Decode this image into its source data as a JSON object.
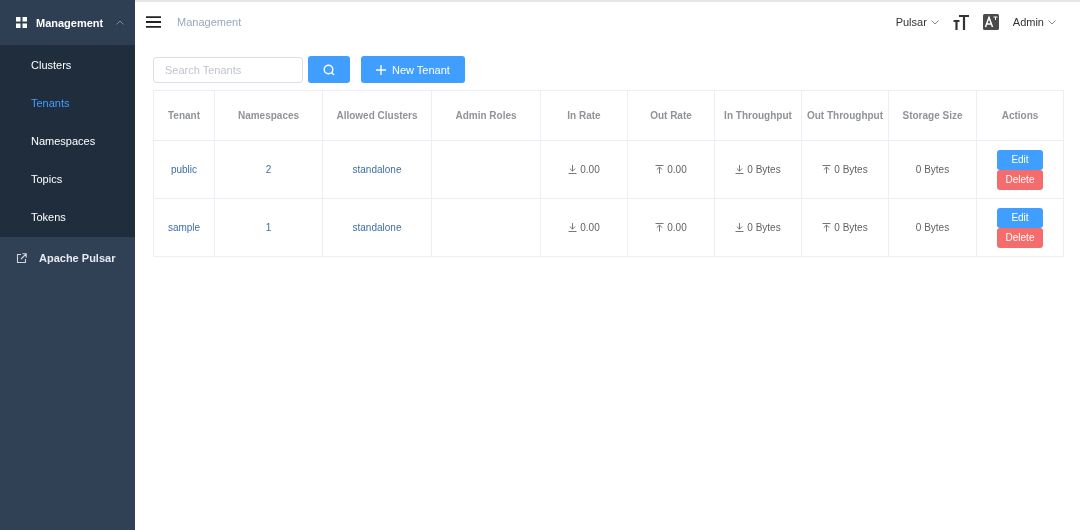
{
  "sidebar": {
    "group": {
      "label": "Management",
      "expanded": true
    },
    "items": [
      {
        "label": "Clusters",
        "selected": false
      },
      {
        "label": "Tenants",
        "selected": true
      },
      {
        "label": "Namespaces",
        "selected": false
      },
      {
        "label": "Topics",
        "selected": false
      },
      {
        "label": "Tokens",
        "selected": false
      }
    ],
    "external_link": "Apache Pulsar"
  },
  "header": {
    "breadcrumb": "Management",
    "cluster_menu": "Pulsar",
    "user_menu": "Admin"
  },
  "toolbar": {
    "search": {
      "placeholder": "Search Tenants"
    },
    "new_button": "New Tenant"
  },
  "table": {
    "columns": [
      "Tenant",
      "Namespaces",
      "Allowed Clusters",
      "Admin Roles",
      "In Rate",
      "Out Rate",
      "In Throughput",
      "Out Throughput",
      "Storage Size",
      "Actions"
    ],
    "rows": [
      {
        "tenant": "public",
        "namespaces": "2",
        "allowed_clusters": "standalone",
        "in_rate": "0.00",
        "out_rate": "0.00",
        "in_throughput": "0 Bytes",
        "out_throughput": "0 Bytes",
        "storage_size": "0 Bytes",
        "actions": [
          "Edit",
          "Delete"
        ]
      },
      {
        "tenant": "sample",
        "namespaces": "1",
        "allowed_clusters": "standalone",
        "in_rate": "0.00",
        "out_rate": "0.00",
        "in_throughput": "0 Bytes",
        "out_throughput": "0 Bytes",
        "storage_size": "0 Bytes",
        "actions": [
          "Edit",
          "Delete"
        ]
      }
    ]
  }
}
